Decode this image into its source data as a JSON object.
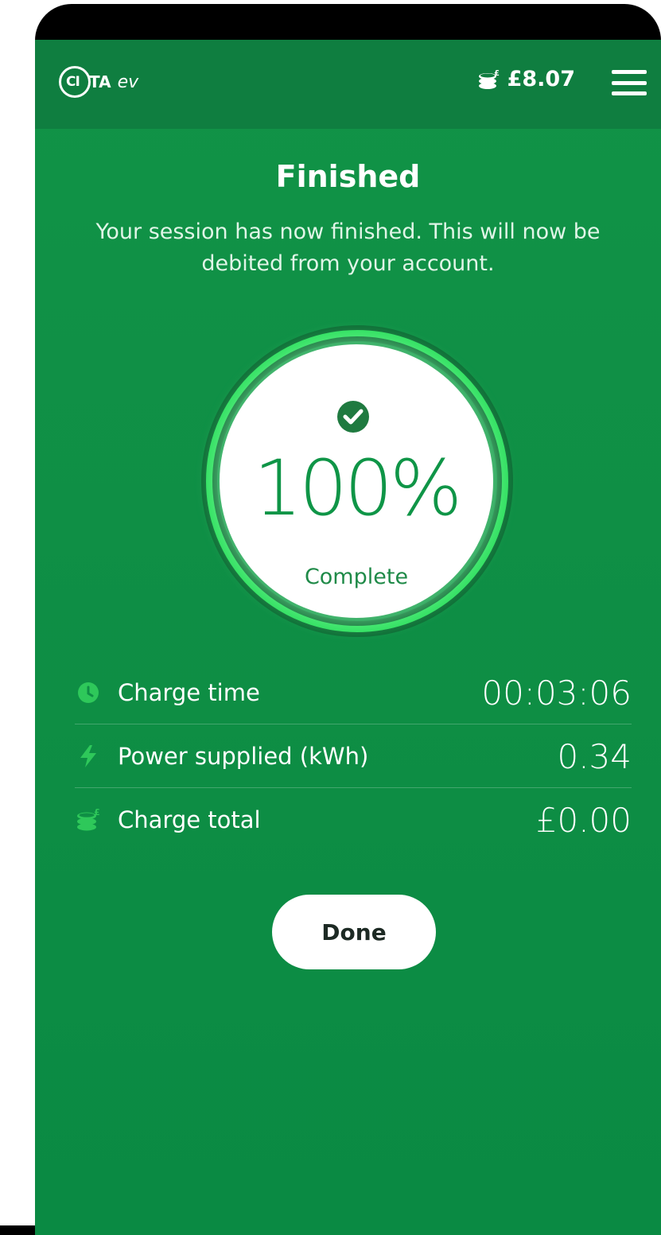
{
  "header": {
    "logo_text": "CITA ev",
    "balance": "£8.07"
  },
  "page": {
    "title": "Finished",
    "subtitle": "Your session has now finished. This will now be debited from your account."
  },
  "progress": {
    "percent_text": "100%",
    "percent_value": 100,
    "status": "Complete"
  },
  "stats": [
    {
      "label": "Charge time",
      "value": "00:03:06",
      "icon": "clock-icon"
    },
    {
      "label": "Power supplied (kWh)",
      "value": "0.34",
      "icon": "lightning-bolt-icon"
    },
    {
      "label": "Charge total",
      "value": "£0.00",
      "icon": "coins-icon"
    }
  ],
  "actions": {
    "done_label": "Done"
  },
  "colors": {
    "background": "#0f8f45",
    "header": "#0f7e40",
    "ring": "#2ee05f",
    "accent": "#2ec85a"
  }
}
